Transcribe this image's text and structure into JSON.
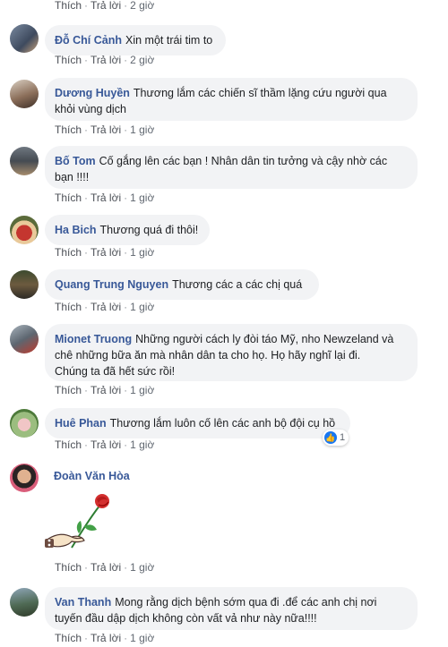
{
  "action_labels": {
    "like": "Thích",
    "reply": "Trả lời",
    "separator": "·"
  },
  "colors": {
    "author": "#385898",
    "bubble": "#f2f3f5",
    "like": "#1877f2"
  },
  "top_actions": {
    "time": "2 giờ"
  },
  "comments": [
    {
      "author": "Đỗ Chí Cảnh",
      "text": "Xin một trái tim to",
      "time": "2 giờ"
    },
    {
      "author": "Dương Huyền",
      "text": "Thương lắm các chiến sĩ thầm lặng cứu người qua\nkhỏi vùng dịch",
      "time": "1 giờ"
    },
    {
      "author": "Bố Tom",
      "text": "Cố gắng lên các bạn ! Nhân dân tin tưởng và cậy nhờ các\nbạn !!!!",
      "time": "1 giờ"
    },
    {
      "author": "Ha Bich",
      "text": "Thương quá đi thôi!",
      "time": "1 giờ"
    },
    {
      "author": "Quang Trung Nguyen",
      "text": "Thương các a các chị quá",
      "time": "1 giờ"
    },
    {
      "author": "Mionet Truong",
      "text": "Những người cách ly đòi táo Mỹ, nho Newzeland và\nchê những bữa ăn mà nhân dân ta cho họ. Họ hãy nghĩ lại đi.\nChúng ta đã hết sức rồi!",
      "time": "1 giờ"
    },
    {
      "author": "Huê Phan",
      "text": "Thương lắm luôn cố lên các anh bộ đội cụ hồ",
      "time": "1 giờ",
      "reaction_count": "1"
    },
    {
      "author": "Đoàn Văn Hòa",
      "text": "",
      "time": "1 giờ",
      "sticker": "hand-holding-rose-sticker"
    },
    {
      "author": "Van Thanh",
      "text": "Mong rằng dịch bệnh sớm qua đi .để các anh chị nơi\ntuyến đầu dập dịch không còn vất vả như này nữa!!!!",
      "time": "1 giờ"
    }
  ]
}
